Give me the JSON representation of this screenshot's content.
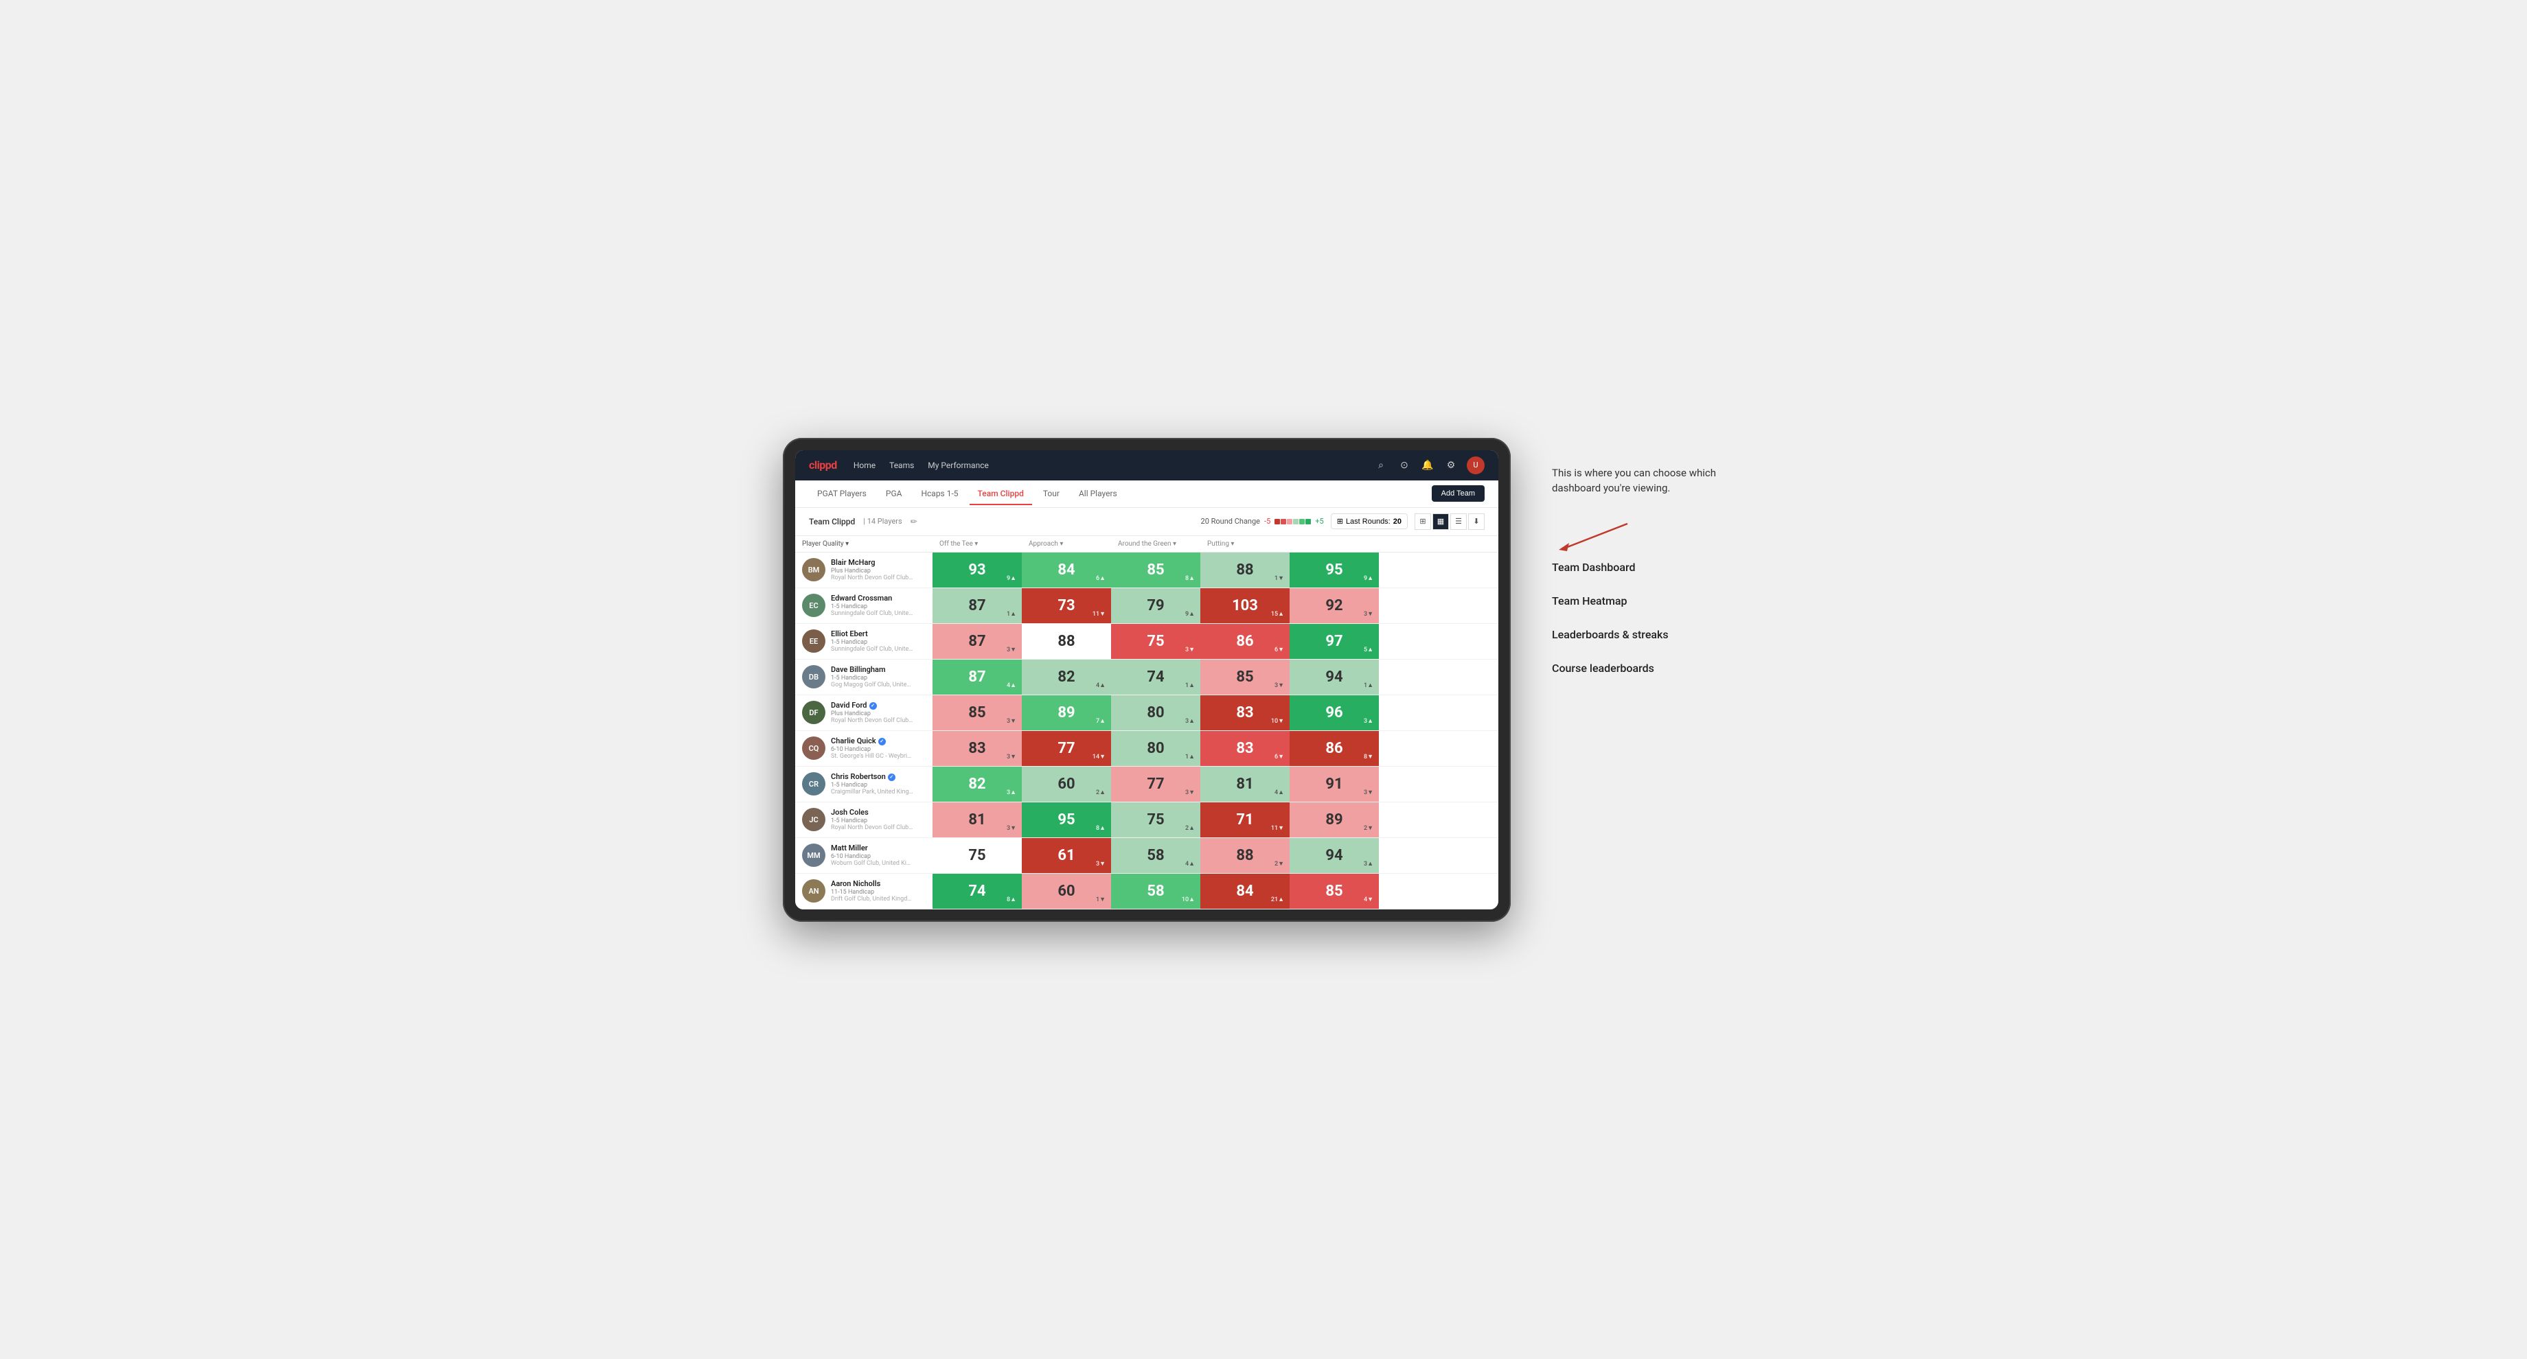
{
  "annotation": {
    "description": "This is where you can choose which dashboard you're viewing.",
    "items": [
      "Team Dashboard",
      "Team Heatmap",
      "Leaderboards & streaks",
      "Course leaderboards"
    ]
  },
  "nav": {
    "logo": "clippd",
    "links": [
      "Home",
      "Teams",
      "My Performance"
    ],
    "icons": [
      "search",
      "user",
      "bell",
      "settings",
      "avatar"
    ]
  },
  "subnav": {
    "tabs": [
      "PGAT Players",
      "PGA",
      "Hcaps 1-5",
      "Team Clippd",
      "Tour",
      "All Players"
    ],
    "active": "Team Clippd",
    "add_team_label": "Add Team"
  },
  "team_header": {
    "name": "Team Clippd",
    "separator": "|",
    "count": "14 Players",
    "round_change_label": "20 Round Change",
    "range_min": "-5",
    "range_max": "+5",
    "last_rounds_label": "Last Rounds:",
    "last_rounds_value": "20"
  },
  "columns": {
    "player": "Player Quality ▾",
    "off_tee": "Off the Tee ▾",
    "approach": "Approach ▾",
    "around_green": "Around the Green ▾",
    "putting": "Putting ▾"
  },
  "players": [
    {
      "name": "Blair McHarg",
      "handicap": "Plus Handicap",
      "club": "Royal North Devon Golf Club, United Kingdom",
      "initials": "BM",
      "avatarColor": "#8B7355",
      "verified": false,
      "scores": {
        "quality": {
          "value": "93",
          "change": "9",
          "dir": "up",
          "bg": "green-dark"
        },
        "off_tee": {
          "value": "84",
          "change": "6",
          "dir": "up",
          "bg": "green-mid"
        },
        "approach": {
          "value": "85",
          "change": "8",
          "dir": "up",
          "bg": "green-mid"
        },
        "around_green": {
          "value": "88",
          "change": "1",
          "dir": "down",
          "bg": "green-light"
        },
        "putting": {
          "value": "95",
          "change": "9",
          "dir": "up",
          "bg": "green-dark"
        }
      }
    },
    {
      "name": "Edward Crossman",
      "handicap": "1-5 Handicap",
      "club": "Sunningdale Golf Club, United Kingdom",
      "initials": "EC",
      "avatarColor": "#5B8A6B",
      "verified": false,
      "scores": {
        "quality": {
          "value": "87",
          "change": "1",
          "dir": "up",
          "bg": "green-light"
        },
        "off_tee": {
          "value": "73",
          "change": "11",
          "dir": "down",
          "bg": "red-dark"
        },
        "approach": {
          "value": "79",
          "change": "9",
          "dir": "up",
          "bg": "green-light"
        },
        "around_green": {
          "value": "103",
          "change": "15",
          "dir": "up",
          "bg": "red-dark"
        },
        "putting": {
          "value": "92",
          "change": "3",
          "dir": "down",
          "bg": "red-light"
        }
      }
    },
    {
      "name": "Elliot Ebert",
      "handicap": "1-5 Handicap",
      "club": "Sunningdale Golf Club, United Kingdom",
      "initials": "EE",
      "avatarColor": "#7B5E4A",
      "verified": false,
      "scores": {
        "quality": {
          "value": "87",
          "change": "3",
          "dir": "down",
          "bg": "red-light"
        },
        "off_tee": {
          "value": "88",
          "change": "",
          "dir": "neutral",
          "bg": "white"
        },
        "approach": {
          "value": "75",
          "change": "3",
          "dir": "down",
          "bg": "red-mid"
        },
        "around_green": {
          "value": "86",
          "change": "6",
          "dir": "down",
          "bg": "red-mid"
        },
        "putting": {
          "value": "97",
          "change": "5",
          "dir": "up",
          "bg": "green-dark"
        }
      }
    },
    {
      "name": "Dave Billingham",
      "handicap": "1-5 Handicap",
      "club": "Gog Magog Golf Club, United Kingdom",
      "initials": "DB",
      "avatarColor": "#6A7B8A",
      "verified": false,
      "scores": {
        "quality": {
          "value": "87",
          "change": "4",
          "dir": "up",
          "bg": "green-mid"
        },
        "off_tee": {
          "value": "82",
          "change": "4",
          "dir": "up",
          "bg": "green-light"
        },
        "approach": {
          "value": "74",
          "change": "1",
          "dir": "up",
          "bg": "green-light"
        },
        "around_green": {
          "value": "85",
          "change": "3",
          "dir": "down",
          "bg": "red-light"
        },
        "putting": {
          "value": "94",
          "change": "1",
          "dir": "up",
          "bg": "green-light"
        }
      }
    },
    {
      "name": "David Ford",
      "handicap": "Plus Handicap",
      "club": "Royal North Devon Golf Club, United Kingdom",
      "initials": "DF",
      "avatarColor": "#4A6741",
      "verified": true,
      "scores": {
        "quality": {
          "value": "85",
          "change": "3",
          "dir": "down",
          "bg": "red-light"
        },
        "off_tee": {
          "value": "89",
          "change": "7",
          "dir": "up",
          "bg": "green-mid"
        },
        "approach": {
          "value": "80",
          "change": "3",
          "dir": "up",
          "bg": "green-light"
        },
        "around_green": {
          "value": "83",
          "change": "10",
          "dir": "down",
          "bg": "red-dark"
        },
        "putting": {
          "value": "96",
          "change": "3",
          "dir": "up",
          "bg": "green-dark"
        }
      }
    },
    {
      "name": "Charlie Quick",
      "handicap": "6-10 Handicap",
      "club": "St. George's Hill GC - Weybridge - Surrey, Uni...",
      "initials": "CQ",
      "avatarColor": "#8B6052",
      "verified": true,
      "scores": {
        "quality": {
          "value": "83",
          "change": "3",
          "dir": "down",
          "bg": "red-light"
        },
        "off_tee": {
          "value": "77",
          "change": "14",
          "dir": "down",
          "bg": "red-dark"
        },
        "approach": {
          "value": "80",
          "change": "1",
          "dir": "up",
          "bg": "green-light"
        },
        "around_green": {
          "value": "83",
          "change": "6",
          "dir": "down",
          "bg": "red-mid"
        },
        "putting": {
          "value": "86",
          "change": "8",
          "dir": "down",
          "bg": "red-dark"
        }
      }
    },
    {
      "name": "Chris Robertson",
      "handicap": "1-5 Handicap",
      "club": "Craigmillar Park, United Kingdom",
      "initials": "CR",
      "avatarColor": "#5A7A8A",
      "verified": true,
      "scores": {
        "quality": {
          "value": "82",
          "change": "3",
          "dir": "up",
          "bg": "green-mid"
        },
        "off_tee": {
          "value": "60",
          "change": "2",
          "dir": "up",
          "bg": "green-light"
        },
        "approach": {
          "value": "77",
          "change": "3",
          "dir": "down",
          "bg": "red-light"
        },
        "around_green": {
          "value": "81",
          "change": "4",
          "dir": "up",
          "bg": "green-light"
        },
        "putting": {
          "value": "91",
          "change": "3",
          "dir": "down",
          "bg": "red-light"
        }
      }
    },
    {
      "name": "Josh Coles",
      "handicap": "1-5 Handicap",
      "club": "Royal North Devon Golf Club, United Kingdom",
      "initials": "JC",
      "avatarColor": "#7A6555",
      "verified": false,
      "scores": {
        "quality": {
          "value": "81",
          "change": "3",
          "dir": "down",
          "bg": "red-light"
        },
        "off_tee": {
          "value": "95",
          "change": "8",
          "dir": "up",
          "bg": "green-dark"
        },
        "approach": {
          "value": "75",
          "change": "2",
          "dir": "up",
          "bg": "green-light"
        },
        "around_green": {
          "value": "71",
          "change": "11",
          "dir": "down",
          "bg": "red-dark"
        },
        "putting": {
          "value": "89",
          "change": "2",
          "dir": "down",
          "bg": "red-light"
        }
      }
    },
    {
      "name": "Matt Miller",
      "handicap": "6-10 Handicap",
      "club": "Woburn Golf Club, United Kingdom",
      "initials": "MM",
      "avatarColor": "#6B7A8B",
      "verified": false,
      "scores": {
        "quality": {
          "value": "75",
          "change": "",
          "dir": "neutral",
          "bg": "white"
        },
        "off_tee": {
          "value": "61",
          "change": "3",
          "dir": "down",
          "bg": "red-dark"
        },
        "approach": {
          "value": "58",
          "change": "4",
          "dir": "up",
          "bg": "green-light"
        },
        "around_green": {
          "value": "88",
          "change": "2",
          "dir": "down",
          "bg": "red-light"
        },
        "putting": {
          "value": "94",
          "change": "3",
          "dir": "up",
          "bg": "green-light"
        }
      }
    },
    {
      "name": "Aaron Nicholls",
      "handicap": "11-15 Handicap",
      "club": "Drift Golf Club, United Kingdom",
      "initials": "AN",
      "avatarColor": "#8B7A55",
      "verified": false,
      "scores": {
        "quality": {
          "value": "74",
          "change": "8",
          "dir": "up",
          "bg": "green-dark"
        },
        "off_tee": {
          "value": "60",
          "change": "1",
          "dir": "down",
          "bg": "red-light"
        },
        "approach": {
          "value": "58",
          "change": "10",
          "dir": "up",
          "bg": "green-mid"
        },
        "around_green": {
          "value": "84",
          "change": "21",
          "dir": "up",
          "bg": "red-dark"
        },
        "putting": {
          "value": "85",
          "change": "4",
          "dir": "down",
          "bg": "red-mid"
        }
      }
    }
  ]
}
